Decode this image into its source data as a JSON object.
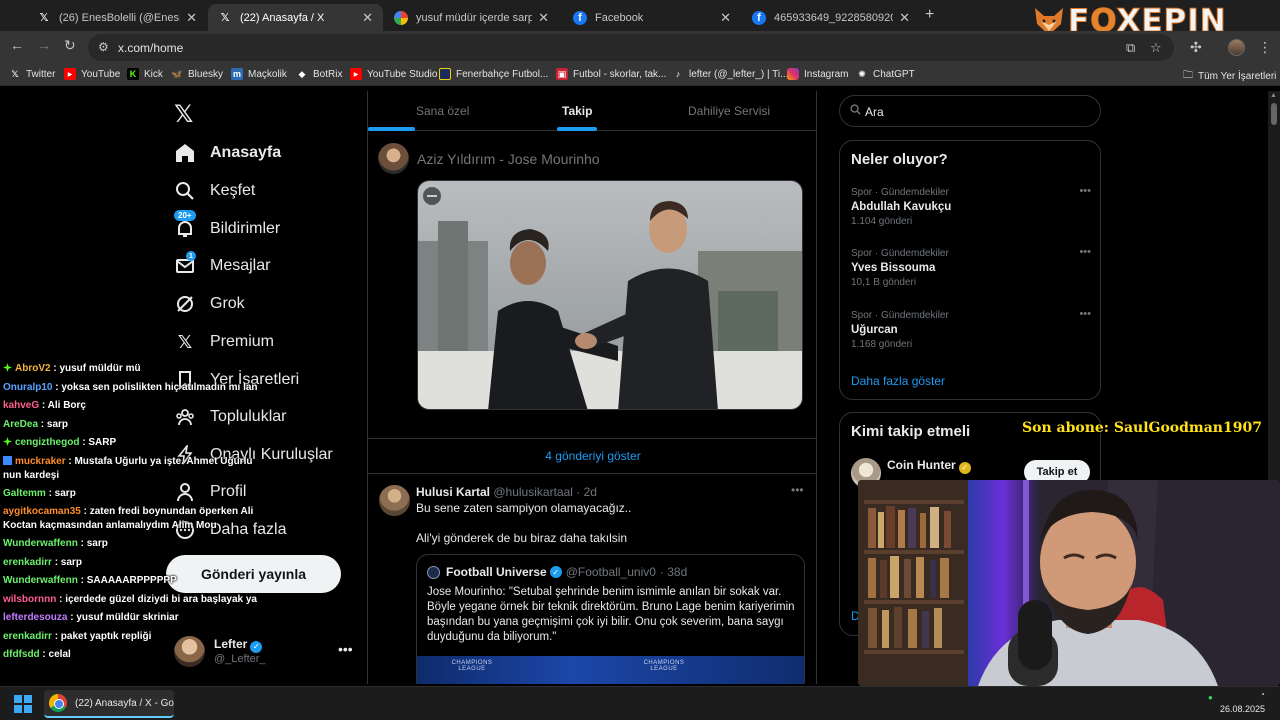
{
  "browser": {
    "tabs": [
      {
        "title": "(26) EnesBolelli (@EnesBolelli) / X",
        "favicon": "x-icon"
      },
      {
        "title": "(22) Anasayfa / X",
        "favicon": "x-icon",
        "active": true
      },
      {
        "title": "yusuf müdür içerde sarp - Google",
        "favicon": "google-icon"
      },
      {
        "title": "Facebook",
        "favicon": "facebook-icon"
      },
      {
        "title": "465933649_922858092050929",
        "favicon": "facebook-icon"
      }
    ],
    "url": "x.com/home",
    "bookmarks": [
      "Twitter",
      "YouTube",
      "Kick",
      "Bluesky",
      "Maçkolik",
      "BotRix",
      "YouTube Studio",
      "Fenerbahçe Futbol...",
      "Futbol - skorlar, tak...",
      "lefter (@_lefter_) | Ti...",
      "Instagram",
      "ChatGPT"
    ],
    "all_bookmarks": "Tüm Yer İşaretleri"
  },
  "overlay": {
    "brand_prefix": "F",
    "brand_o": "O",
    "brand_suffix": "XEPIN",
    "sub_alert": "Son abone: SaulGoodman1907"
  },
  "nav": {
    "items": [
      {
        "label": "Anasayfa",
        "icon": "home-icon"
      },
      {
        "label": "Keşfet",
        "icon": "search-icon"
      },
      {
        "label": "Bildirimler",
        "icon": "bell-icon",
        "badge": "20+"
      },
      {
        "label": "Mesajlar",
        "icon": "mail-icon",
        "badge": "1"
      },
      {
        "label": "Grok",
        "icon": "grok-icon"
      },
      {
        "label": "Premium",
        "icon": "x-premium-icon"
      },
      {
        "label": "Yer İşaretleri",
        "icon": "bookmark-icon"
      },
      {
        "label": "Topluluklar",
        "icon": "communities-icon"
      },
      {
        "label": "Onaylı Kuruluşlar",
        "icon": "lightning-icon"
      },
      {
        "label": "Profil",
        "icon": "person-icon"
      },
      {
        "label": "Daha fazla",
        "icon": "more-circle-icon"
      }
    ],
    "post_button": "Gönderi yayınla",
    "account": {
      "name": "Lefter",
      "handle": "@_Lefter_"
    }
  },
  "timeline": {
    "tabs": [
      "Sana özel",
      "Takip",
      "Dahiliye Servisi"
    ],
    "compose_text": "Aziz Yıldırım - Jose Mourinho",
    "show_more_posts": "4 gönderiyi göster",
    "tweet": {
      "name": "Hulusi Kartal",
      "handle": "@hulusikartaal",
      "time": "· 2d",
      "line1": "Bu sene zaten sampiyon olamayacağız..",
      "line2": "Ali'yi gönderek de bu biraz daha takılsin",
      "quote": {
        "name": "Football Universe",
        "handle": "@Football_univ0",
        "time": "· 38d",
        "text": "Jose Mourinho: \"Setubal şehrinde benim ismimle anılan bir sokak var. Böyle yegane örnek bir teknik direktörüm. Bruno Lage benim kariyerimin başından bu yana geçmişimi çok iyi bilir. Onu çok severim, bana saygı duyduğunu da biliyorum.\"",
        "media_label_left": "CHAMPIONS LEAGUE",
        "media_label_right": "CHAMPIONS LEAGUE"
      }
    }
  },
  "right": {
    "search_text": "Ara",
    "trends_title": "Neler oluyor?",
    "trends": [
      {
        "category": "Spor · Gündemdekiler",
        "name": "Abdullah Kavukçu",
        "count": "1.104 gönderi"
      },
      {
        "category": "Spor · Gündemdekiler",
        "name": "Yves Bissouma",
        "count": "10,1 B gönderi"
      },
      {
        "category": "Spor · Gündemdekiler",
        "name": "Uğurcan",
        "count": "1.168 gönderi"
      }
    ],
    "show_more": "Daha fazla göster",
    "who_title": "Kimi takip etmeli",
    "who": {
      "name": "Coin Hunter",
      "button": "Takip et"
    },
    "partial_link": "Da"
  },
  "chat": [
    {
      "user": "AbroV2",
      "color": "#f0b43c",
      "text": " : yusuf müldür mü",
      "badge": "green"
    },
    {
      "user": "Onuralp10",
      "color": "#5aa2ff",
      "text": " : yoksa sen polislikten hiç atılmadın mı lan"
    },
    {
      "user": "kahveG",
      "color": "#ff5f8f",
      "text": " : Ali Borç"
    },
    {
      "user": "AreDea",
      "color": "#6cf06c",
      "text": " : sarp"
    },
    {
      "user": "cengizthegod",
      "color": "#6cf06c",
      "text": " : SARP",
      "badge": "green"
    },
    {
      "user": "muckraker",
      "color": "#ff8c2a",
      "text": " : Mustafa Uğurlu ya işte. Ahmet Uğurlu nun kardeşi",
      "badge": "blue",
      "wrap": true
    },
    {
      "user": "Galtemm",
      "color": "#6cf06c",
      "text": " : sarp"
    },
    {
      "user": "aygitkocaman35",
      "color": "#ff8c2a",
      "text": " : zaten fredi boynundan öperken Ali Koctan kaçmasından anlamalıydım Alim Mou",
      "wrap": true
    },
    {
      "user": "Wunderwaffenn",
      "color": "#6cf06c",
      "text": " : sarp"
    },
    {
      "user": "erenkadirr",
      "color": "#6cf06c",
      "text": " : sarp"
    },
    {
      "user": "Wunderwaffenn",
      "color": "#6cf06c",
      "text": " : SAAAAARPPPPPP"
    },
    {
      "user": "wilsbornnn",
      "color": "#ff5f8f",
      "text": " : içerdede güzel diziydi bi ara başlayak ya"
    },
    {
      "user": "lefterdesouza",
      "color": "#c27cff",
      "text": " : yusuf müldür skriniar"
    },
    {
      "user": "erenkadirr",
      "color": "#6cf06c",
      "text": " : paket yaptık repliği"
    },
    {
      "user": "dfdfsdd",
      "color": "#6cf06c",
      "text": " : celal"
    }
  ],
  "taskbar": {
    "app_title": "(22) Anasayfa / X - Goo",
    "date": "26.08.2025"
  }
}
